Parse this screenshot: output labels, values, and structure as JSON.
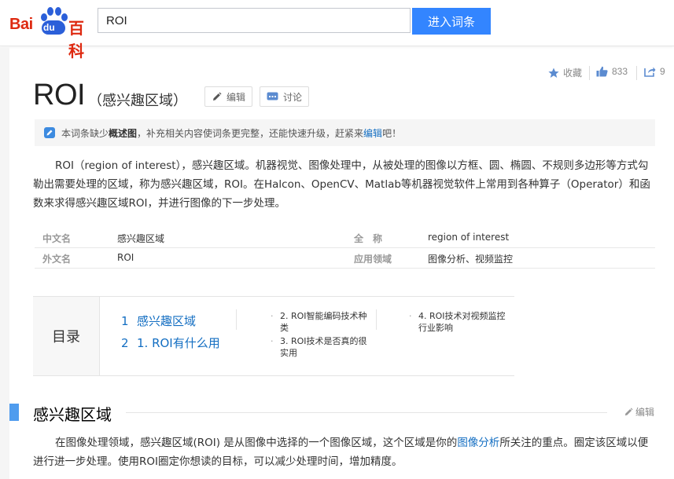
{
  "header": {
    "logo": {
      "bai": "Bai",
      "du": "du",
      "baike": "百科"
    },
    "search": {
      "value": "ROI"
    },
    "search_button": "进入词条"
  },
  "actions": {
    "favorite_label": "收藏",
    "like_count": "833",
    "share_count": "9"
  },
  "entry": {
    "title": "ROI",
    "subtitle": "（感兴趣区域）",
    "edit_label": "编辑",
    "discuss_label": "讨论"
  },
  "notice": {
    "prefix": "本词条缺少",
    "bold": "概述图",
    "middle": "，补充相关内容使词条更完整，还能快速升级，赶紧来",
    "link": "编辑",
    "suffix": "吧！"
  },
  "summary": "ROI（region of interest），感兴趣区域。机器视觉、图像处理中，从被处理的图像以方框、圆、椭圆、不规则多边形等方式勾勒出需要处理的区域，称为感兴趣区域，ROI。在Halcon、OpenCV、Matlab等机器视觉软件上常用到各种算子（Operator）和函数来求得感兴趣区域ROI，并进行图像的下一步处理。",
  "basic_info": [
    {
      "name": "中文名",
      "value": "感兴趣区域",
      "name2": "全　称",
      "value2": "region of interest"
    },
    {
      "name": "外文名",
      "value": "ROI",
      "name2": "应用领域",
      "value2": "图像分析、视频监控"
    }
  ],
  "toc": {
    "label": "目录",
    "items": [
      {
        "num": "1",
        "text": "感兴趣区域"
      },
      {
        "num": "2",
        "text": "1. ROI有什么用"
      }
    ],
    "subitems": [
      "2. ROI智能编码技术种类",
      "3. ROI技术是否真的很实用",
      "4. ROI技术对视频监控行业影响"
    ]
  },
  "section": {
    "title": "感兴趣区域",
    "edit_label": "编辑",
    "text_before": "在图像处理领域，感兴趣区域(ROI) 是从图像中选择的一个图像区域，这个区域是你的",
    "text_link": "图像分析",
    "text_after": "所关注的重点。圈定该区域以便进行进一步处理。使用ROI圈定你想读的目标，可以减少处理时间，增加精度。"
  }
}
